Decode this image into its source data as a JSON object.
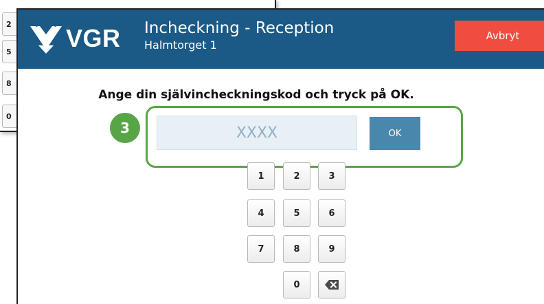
{
  "background_window": {
    "keys": [
      "2",
      "5",
      "8",
      "0"
    ]
  },
  "header": {
    "logo_text": "VGR",
    "title": "Incheckning - Reception",
    "subtitle": "Halmtorget 1",
    "cancel_label": "Avbryt",
    "background_color": "#1b5a87",
    "cancel_color": "#f04c3f"
  },
  "main": {
    "instruction": "Ange din självincheckningskod och tryck på OK.",
    "code_input": {
      "value": "",
      "placeholder": "XXXX"
    },
    "ok_label": "OK",
    "step_number": "3",
    "highlight_color": "#58a548"
  },
  "keypad": {
    "keys": [
      "1",
      "2",
      "3",
      "4",
      "5",
      "6",
      "7",
      "8",
      "9",
      "0"
    ],
    "backspace_icon": "backspace-icon"
  }
}
